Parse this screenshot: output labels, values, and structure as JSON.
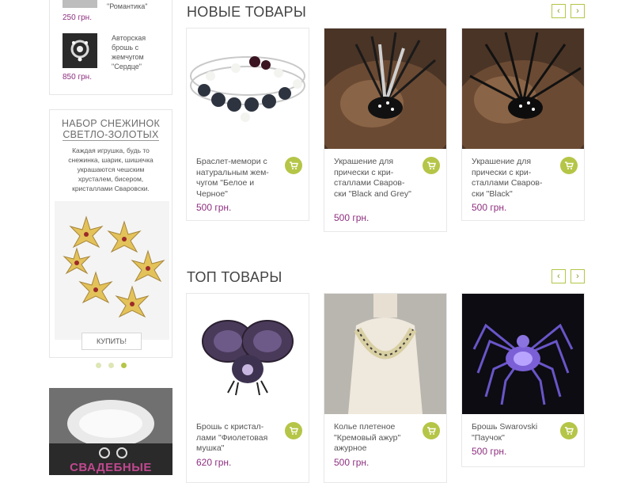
{
  "sidebar": {
    "mini_products": [
      {
        "name": "\"Романтика\"",
        "price": "250 грн."
      },
      {
        "name": "Авторская брошь с жемчугом \"Сердце\"",
        "price": "850 грн."
      }
    ],
    "promo": {
      "title_line1": "НАБОР СНЕЖИНОК",
      "title_line2": "СВЕТЛО-ЗОЛОТЫХ",
      "text": "Каждая игрушка, будь то снежинка, шарик, шишечка украшаются чешским хрусталем, бисером, кристаллами Сваровски.",
      "button": "КУПИТЬ!"
    },
    "banner_text": "СВАДЕБНЫЕ"
  },
  "new_products": {
    "title": "НОВЫЕ ТОВАРЫ",
    "items": [
      {
        "name": "Браслет-мемори с натуральным жем-чугом \"Белое и Черное\"",
        "price": "500 грн."
      },
      {
        "name": "Украшение для прически с кри-сталлами Сваров-ски \"Black and Grey\"",
        "price": "500 грн."
      },
      {
        "name": "Украшение для прически с кри-сталлами Сваров-ски \"Black\"",
        "price": "500 грн."
      }
    ]
  },
  "top_products": {
    "title": "ТОП ТОВАРЫ",
    "items": [
      {
        "name": "Брошь с кристал-лами \"Фиолетовая мушка\"",
        "price": "620 грн."
      },
      {
        "name": "Колье плетеное \"Кремовый ажур\" ажурное",
        "price": "500 грн."
      },
      {
        "name": "Брошь Swarovski \"Паучок\"",
        "price": "500 грн."
      }
    ]
  },
  "colors": {
    "accent": "#b5c547",
    "price": "#8e2f7f"
  },
  "icons": {
    "prev": "chevron-left-icon",
    "next": "chevron-right-icon",
    "cart": "cart-icon"
  }
}
